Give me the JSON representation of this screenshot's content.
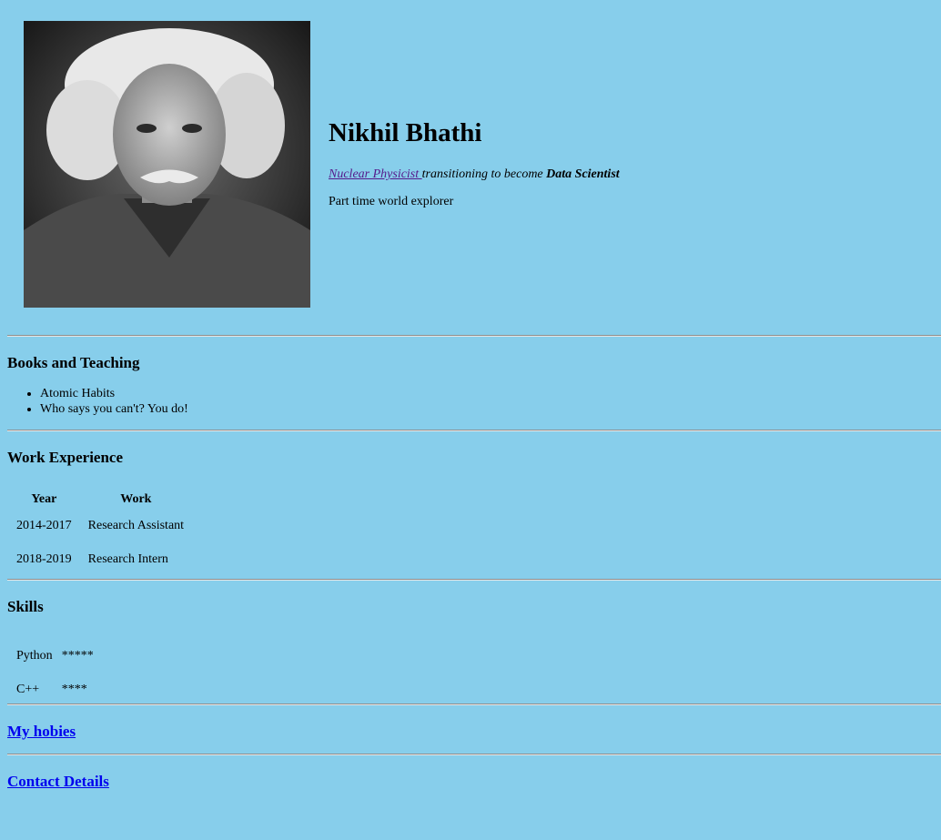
{
  "profile": {
    "name": "Nikhil Bhathi",
    "link_text": "Nuclear Physicist ",
    "transition_text": "transitioning to become ",
    "target_role": "Data Scientist",
    "explorer": "Part time world explorer"
  },
  "books": {
    "heading": "Books and Teaching",
    "items": [
      "Atomic Habits",
      "Who says you can't? You do!"
    ]
  },
  "work": {
    "heading": "Work Experience",
    "columns": [
      "Year",
      "Work"
    ],
    "rows": [
      [
        "2014-2017",
        "Research Assistant"
      ],
      [
        "2018-2019",
        "Research Intern"
      ]
    ]
  },
  "skills": {
    "heading": "Skills",
    "rows": [
      [
        "Python",
        "*****"
      ],
      [
        "C++",
        "****"
      ]
    ]
  },
  "links": {
    "hobbies": "My hobies",
    "contact": "Contact Details"
  },
  "colors": {
    "background": "#87ceeb",
    "link": "#0000ee",
    "visited_link": "#551a8b"
  }
}
